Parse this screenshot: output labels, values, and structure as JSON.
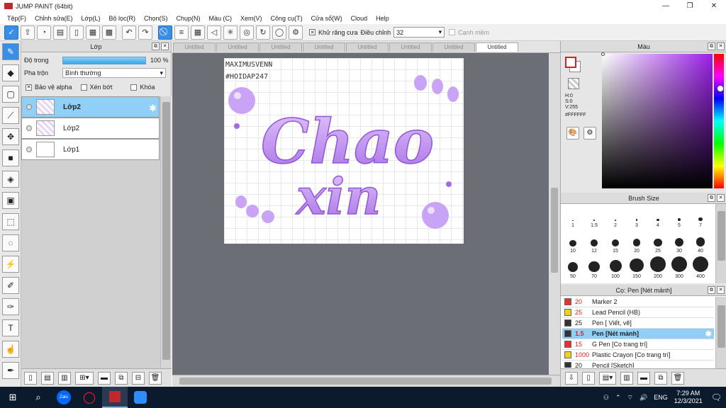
{
  "window": {
    "title": "JUMP PAINT (64bit)",
    "minimize": "—",
    "restore": "❐",
    "close": "✕"
  },
  "menu": [
    "Tệp(F)",
    "Chỉnh sửa(E)",
    "Lớp(L)",
    "Bộ lọc(R)",
    "Chọn(S)",
    "Chụp(N)",
    "Màu (C)",
    "Xem(V)",
    "Công cụ(T)",
    "Cửa sổ(W)",
    "Cloud",
    "Help"
  ],
  "toolbar": {
    "antialias_label": "Khử răng cưa",
    "adjust_label": "Điều chỉnh",
    "adjust_value": "32",
    "smooth_label": "Cạnh mềm"
  },
  "layer_panel": {
    "title": "Lớp",
    "opacity_label": "Độ trong",
    "opacity_value": "100 %",
    "opacity_fraction": 1.0,
    "blend_label": "Pha trộn",
    "blend_value": "Bình thường",
    "protect_alpha": "Bảo vệ alpha",
    "clip": "Xén bớt",
    "lock": "Khóa",
    "layers": [
      {
        "name": "Lớp2",
        "selected": true
      },
      {
        "name": "Lớp2",
        "selected": false
      },
      {
        "name": "Lớp1",
        "selected": false
      }
    ]
  },
  "tabs": [
    "Untitled",
    "Untitled",
    "Untitled",
    "Untitled",
    "Untitled",
    "Untitled",
    "Untitled",
    "Untitled"
  ],
  "active_tab_index": 7,
  "artwork": {
    "credit_line1": "MAXIMUSVENN",
    "credit_line2": "#HOIDAP247",
    "word1": "Chao",
    "word2": "xin",
    "letter_color": "#b988ee"
  },
  "color_panel": {
    "title": "Màu",
    "h": "H:0",
    "s": "S:0",
    "v": "V:255",
    "hex": "#FFFFFF",
    "fg_color": "#FFFFFF",
    "hue_color": "#9b20e8"
  },
  "brush_panel": {
    "title": "Brush Size",
    "sizes": [
      "1",
      "1.5",
      "2",
      "3",
      "4",
      "5",
      "7",
      "10",
      "12",
      "15",
      "20",
      "25",
      "30",
      "40",
      "50",
      "70",
      "100",
      "150",
      "200",
      "300",
      "400"
    ]
  },
  "pen_panel": {
    "title": "Cọ: Pen [Nét mảnh]",
    "items": [
      {
        "size": "20",
        "name": "Marker 2",
        "color": "#e83232"
      },
      {
        "size": "25",
        "name": "Lead Pencil (HB)",
        "color": "#f0d020"
      },
      {
        "size": "25",
        "name": "Pen [ Viết, vẽ]",
        "color": "#333333"
      },
      {
        "size": "1.5",
        "name": "Pen [Nét mảnh]",
        "color": "#333333",
        "selected": true
      },
      {
        "size": "15",
        "name": "G Pen [Co trang trí]",
        "color": "#e83232"
      },
      {
        "size": "1000",
        "name": "Plastic Crayon [Co trang trí]",
        "color": "#f0d020"
      },
      {
        "size": "20",
        "name": "Pencil [Sketch]",
        "color": "#333333"
      }
    ]
  },
  "taskbar": {
    "lang": "ENG",
    "time": "7:29 AM",
    "date": "12/3/2021",
    "zalo": "Zalo"
  }
}
